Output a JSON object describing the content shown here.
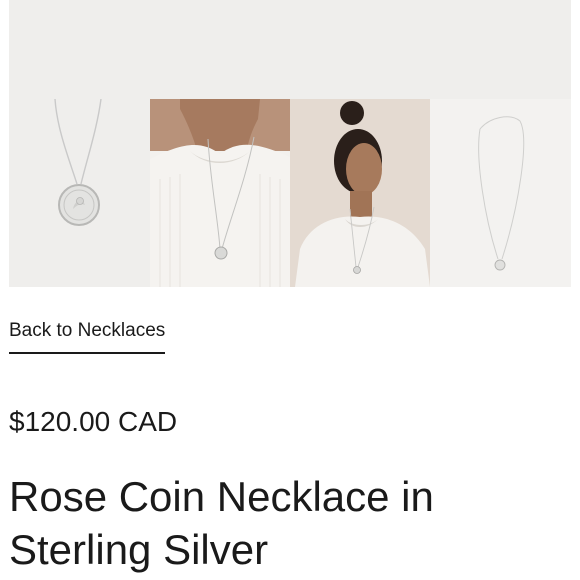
{
  "gallery": {
    "images": [
      {
        "icon": "necklace-product-image"
      },
      {
        "icon": "model-closeup-image"
      },
      {
        "icon": "model-portrait-image"
      },
      {
        "icon": "necklace-flat-image"
      }
    ]
  },
  "nav": {
    "back_label": "Back to Necklaces"
  },
  "product": {
    "price": "$120.00 CAD",
    "title": "Rose Coin Necklace in Sterling Silver"
  }
}
